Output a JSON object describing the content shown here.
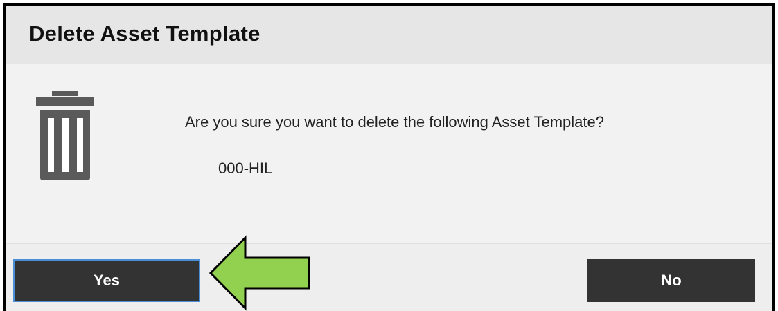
{
  "dialog": {
    "title": "Delete Asset Template",
    "message": "Are you sure you want to delete the following Asset Template?",
    "item_name": "000-HIL",
    "icon": "trash-icon"
  },
  "buttons": {
    "yes_label": "Yes",
    "no_label": "No"
  },
  "annotation": {
    "icon": "arrow-left-icon",
    "color": "#92d050"
  },
  "colors": {
    "button_bg": "#333333",
    "button_focus_border": "#4a8fd6",
    "icon_gray": "#5a5a5a"
  }
}
